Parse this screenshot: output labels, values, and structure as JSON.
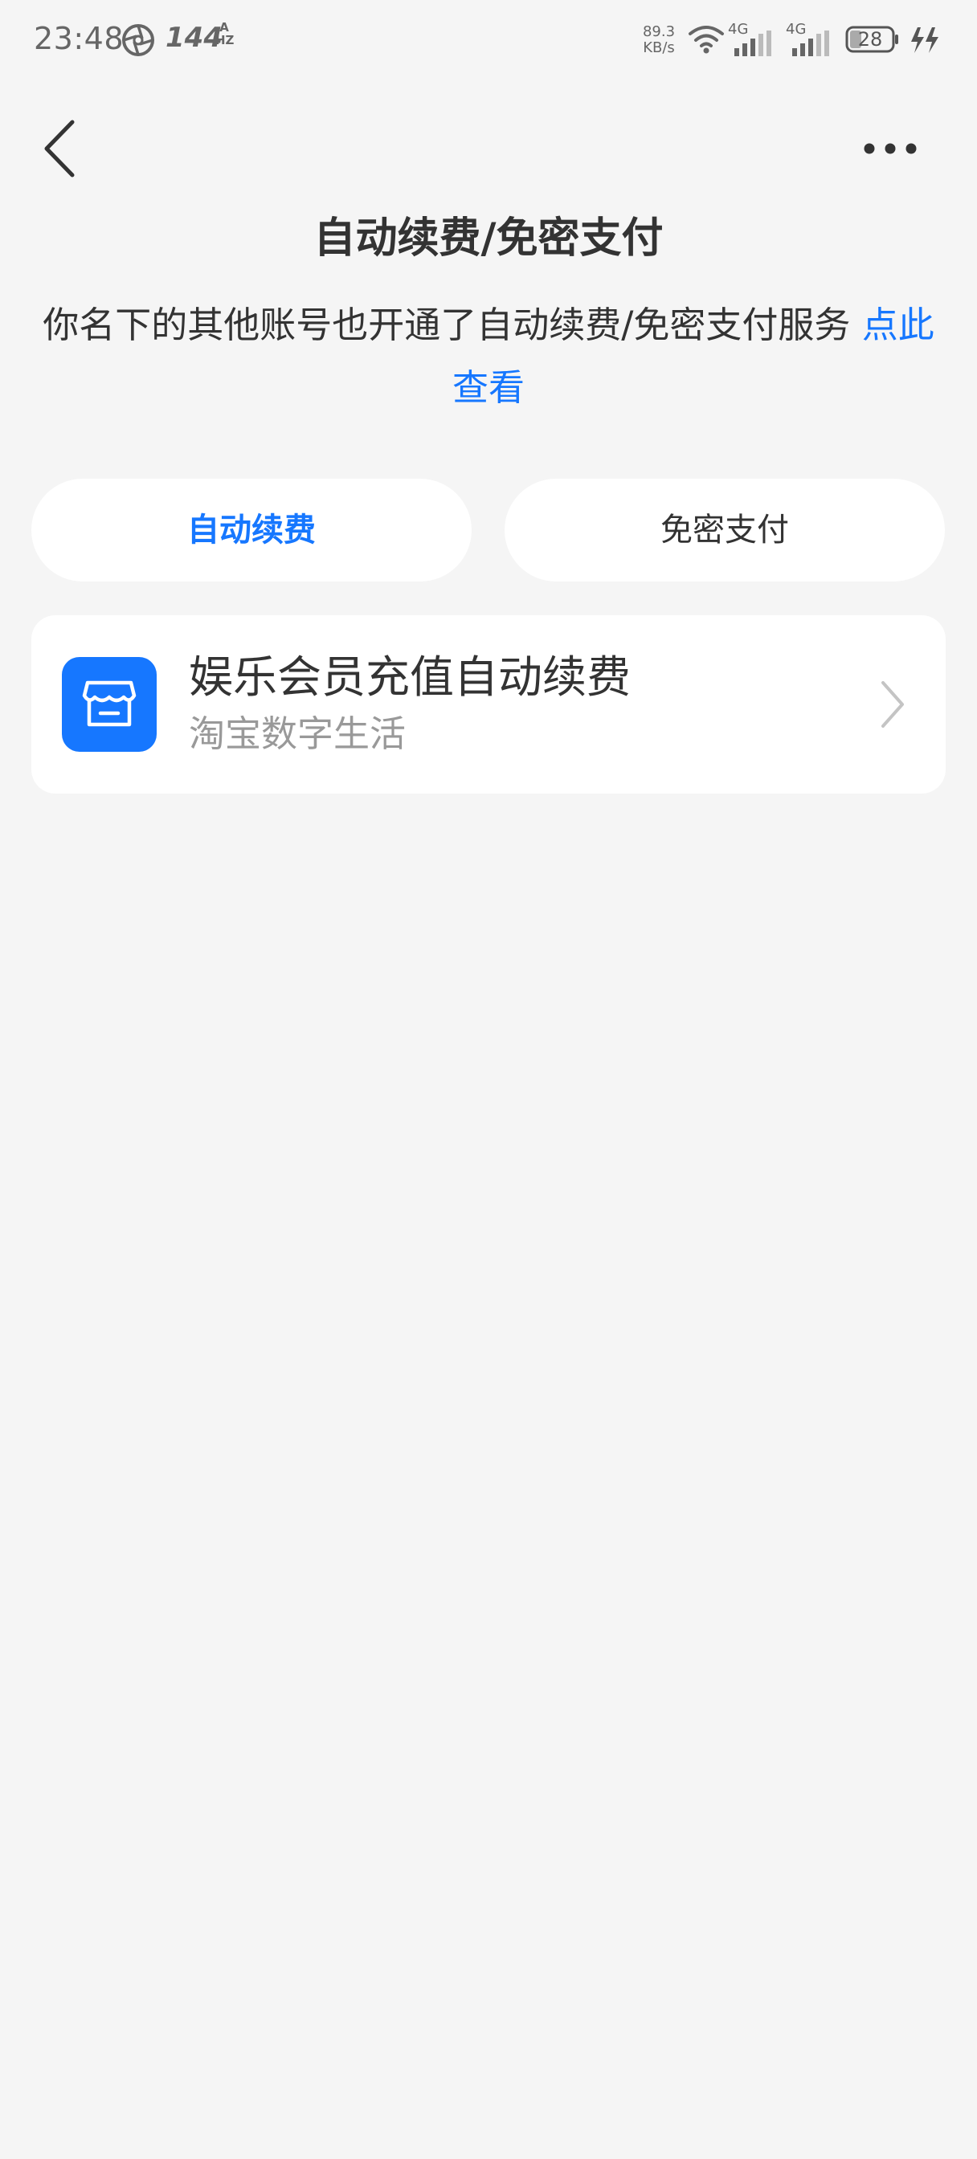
{
  "status_bar": {
    "time": "23:48",
    "refresh_rate": "144",
    "refresh_rate_suffix_top": "A",
    "refresh_rate_suffix_bottom": "HZ",
    "net_speed_value": "89.3",
    "net_speed_unit": "KB/s",
    "signal_1_label": "4G",
    "signal_2_label": "4G",
    "battery": "28"
  },
  "header": {
    "title": "自动续费/免密支付"
  },
  "notice": {
    "text": "你名下的其他账号也开通了自动续费/免密支付服务 ",
    "link": "点此查看"
  },
  "tabs": [
    {
      "label": "自动续费",
      "active": true
    },
    {
      "label": "免密支付",
      "active": false
    }
  ],
  "services": [
    {
      "title": "娱乐会员充值自动续费",
      "subtitle": "淘宝数字生活",
      "icon": "store-icon"
    }
  ],
  "colors": {
    "accent": "#1677ff",
    "background": "#f5f5f5",
    "card": "#ffffff",
    "text_primary": "#333333",
    "text_secondary": "#999999"
  }
}
